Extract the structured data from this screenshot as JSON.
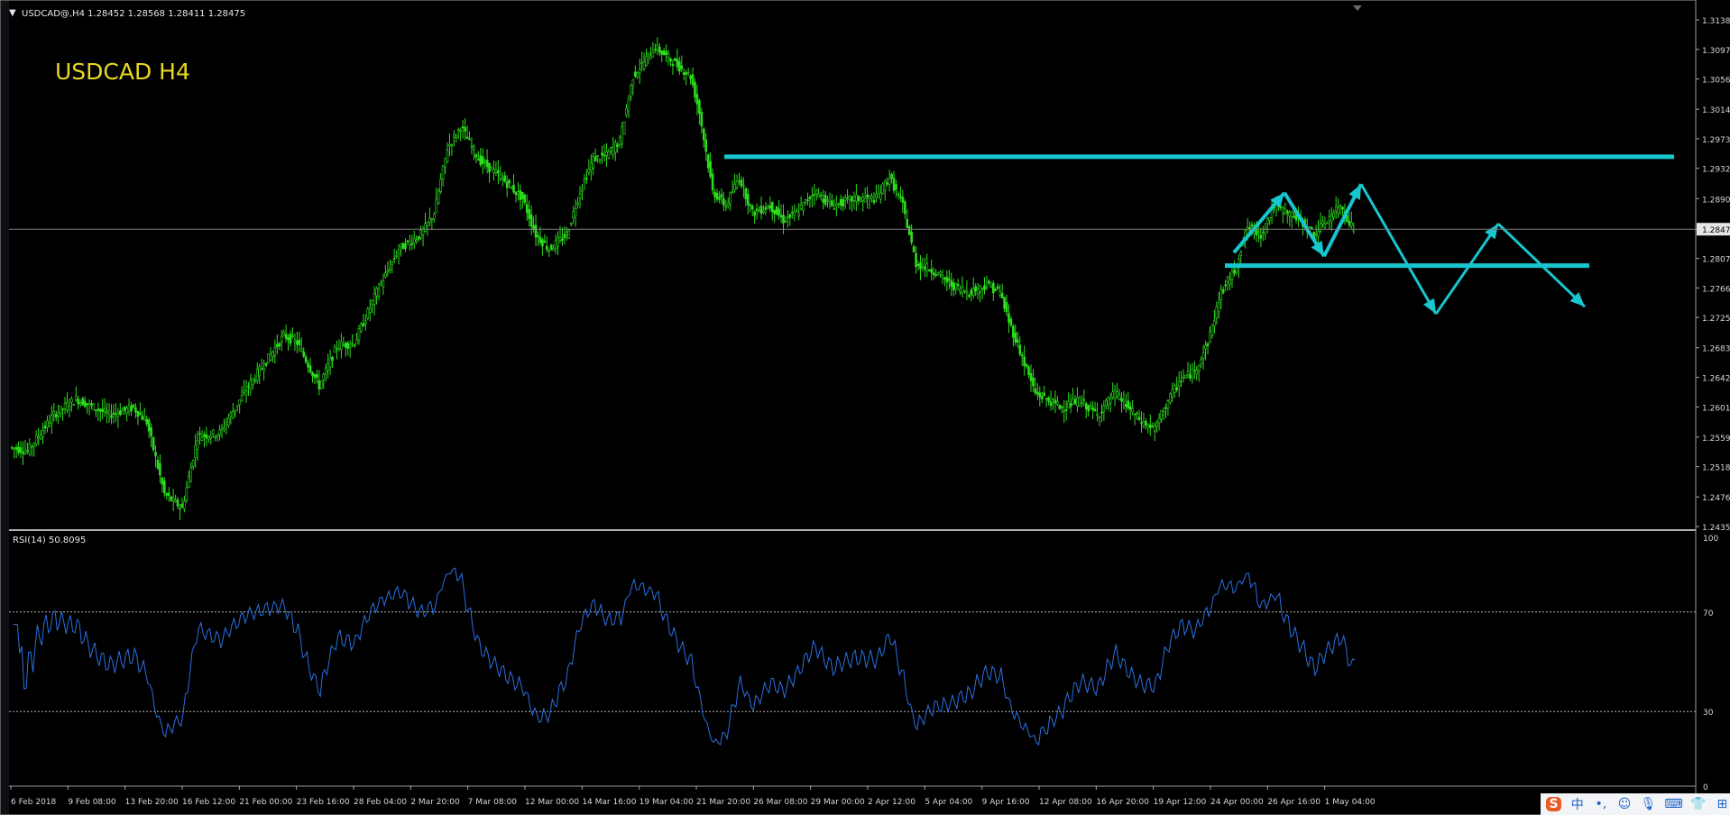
{
  "header": {
    "label": "USDCAD@,H4  1.28452 1.28568 1.28411 1.28475",
    "watermark": "USDCAD  H4",
    "current_price": "1.28475"
  },
  "chart_data": {
    "type": "candlestick",
    "symbol": "USDCAD",
    "timeframe": "H4",
    "ohlc": {
      "open": 1.28452,
      "high": 1.28568,
      "low": 1.28411,
      "close": 1.28475
    },
    "ylim": [
      1.2435,
      1.3138
    ],
    "y_ticks": [
      "1.31380",
      "1.30970",
      "1.30560",
      "1.30140",
      "1.29730",
      "1.29320",
      "1.28900",
      "1.28475",
      "1.28070",
      "1.27660",
      "1.27250",
      "1.26830",
      "1.26420",
      "1.26010",
      "1.25590",
      "1.25180",
      "1.24760",
      "1.24350"
    ],
    "x_ticks": [
      "6 Feb 2018",
      "9 Feb 08:00",
      "13 Feb 20:00",
      "16 Feb 12:00",
      "21 Feb 00:00",
      "23 Feb 16:00",
      "28 Feb 04:00",
      "2 Mar 20:00",
      "7 Mar 08:00",
      "12 Mar 00:00",
      "14 Mar 16:00",
      "19 Mar 04:00",
      "21 Mar 20:00",
      "26 Mar 08:00",
      "29 Mar 00:00",
      "2 Apr 12:00",
      "5 Apr 04:00",
      "9 Apr 16:00",
      "12 Apr 08:00",
      "16 Apr 20:00",
      "19 Apr 12:00",
      "24 Apr 00:00",
      "26 Apr 16:00",
      "1 May 04:00"
    ],
    "price_path": [
      [
        0,
        1.2545
      ],
      [
        8,
        1.254
      ],
      [
        20,
        1.259
      ],
      [
        30,
        1.2612
      ],
      [
        45,
        1.259
      ],
      [
        56,
        1.26
      ],
      [
        62,
        1.258
      ],
      [
        70,
        1.248
      ],
      [
        78,
        1.246
      ],
      [
        85,
        1.256
      ],
      [
        95,
        1.2565
      ],
      [
        108,
        1.263
      ],
      [
        115,
        1.266
      ],
      [
        124,
        1.27
      ],
      [
        130,
        1.269
      ],
      [
        135,
        1.266
      ],
      [
        140,
        1.263
      ],
      [
        148,
        1.2685
      ],
      [
        156,
        1.269
      ],
      [
        166,
        1.276
      ],
      [
        176,
        1.282
      ],
      [
        186,
        1.284
      ],
      [
        192,
        1.287
      ],
      [
        198,
        1.296
      ],
      [
        204,
        1.299
      ],
      [
        212,
        1.2945
      ],
      [
        222,
        1.292
      ],
      [
        232,
        1.289
      ],
      [
        238,
        1.284
      ],
      [
        244,
        1.282
      ],
      [
        252,
        1.284
      ],
      [
        258,
        1.29
      ],
      [
        264,
        1.2945
      ],
      [
        270,
        1.295
      ],
      [
        276,
        1.297
      ],
      [
        282,
        1.306
      ],
      [
        292,
        1.31
      ],
      [
        300,
        1.308
      ],
      [
        308,
        1.306
      ],
      [
        312,
        1.301
      ],
      [
        318,
        1.29
      ],
      [
        324,
        1.288
      ],
      [
        330,
        1.292
      ],
      [
        336,
        1.287
      ],
      [
        344,
        1.288
      ],
      [
        350,
        1.286
      ],
      [
        356,
        1.287
      ],
      [
        364,
        1.29
      ],
      [
        372,
        1.288
      ],
      [
        382,
        1.289
      ],
      [
        392,
        1.289
      ],
      [
        398,
        1.292
      ],
      [
        404,
        1.288
      ],
      [
        410,
        1.28
      ],
      [
        418,
        1.279
      ],
      [
        426,
        1.277
      ],
      [
        434,
        1.276
      ],
      [
        442,
        1.277
      ],
      [
        448,
        1.276
      ],
      [
        452,
        1.272
      ],
      [
        458,
        1.267
      ],
      [
        464,
        1.262
      ],
      [
        470,
        1.261
      ],
      [
        476,
        1.26
      ],
      [
        484,
        1.261
      ],
      [
        492,
        1.259
      ],
      [
        500,
        1.262
      ],
      [
        506,
        1.26
      ],
      [
        512,
        1.258
      ],
      [
        518,
        1.257
      ],
      [
        524,
        1.261
      ],
      [
        530,
        1.264
      ],
      [
        536,
        1.265
      ],
      [
        542,
        1.269
      ],
      [
        548,
        1.276
      ],
      [
        554,
        1.279
      ],
      [
        560,
        1.285
      ],
      [
        566,
        1.284
      ],
      [
        572,
        1.288
      ],
      [
        578,
        1.287
      ],
      [
        584,
        1.286
      ],
      [
        590,
        1.284
      ],
      [
        596,
        1.286
      ],
      [
        602,
        1.288
      ],
      [
        608,
        1.2847
      ]
    ],
    "rsi": {
      "label": "RSI(14) 50.8095",
      "period": 14,
      "value": 50.8095,
      "ylim": [
        0,
        100
      ],
      "levels": [
        30,
        70
      ],
      "y_ticks": [
        "100",
        "70",
        "30",
        "0"
      ],
      "color": "#2b6fe0"
    },
    "drawings": {
      "resistance_level": 1.2948,
      "support_level": 1.2797,
      "projection_path": [
        [
          1.2815,
          1.2898
        ],
        [
          1.281,
          1.291
        ],
        [
          1.273,
          1.2855
        ],
        [
          1.276,
          1.274
        ]
      ],
      "color": "#17c6cf"
    },
    "colors": {
      "candle": "#2cdd1c",
      "background": "#000000",
      "grid": "#808080",
      "axis_text": "#d8d8d8"
    },
    "grid": false,
    "legend": "none"
  },
  "ime": {
    "logo": "S",
    "lang": "中",
    "punct": "•,",
    "emoji": "☺",
    "mic": "🎙",
    "keyboard": "⌨",
    "shirt": "👕",
    "apps": "⊞"
  }
}
